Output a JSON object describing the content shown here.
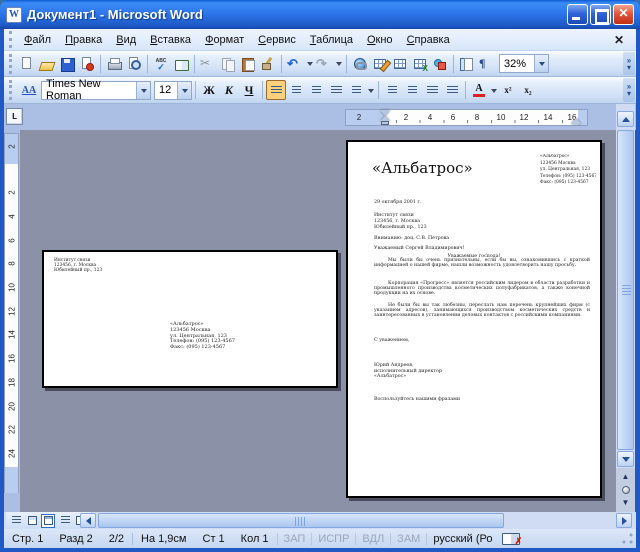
{
  "window": {
    "title": "Документ1 - Microsoft Word"
  },
  "menu": {
    "items": [
      "Файл",
      "Правка",
      "Вид",
      "Вставка",
      "Формат",
      "Сервис",
      "Таблица",
      "Окно",
      "Справка"
    ]
  },
  "standard_toolbar": {
    "zoom_value": "32%",
    "spell_label": "ABC",
    "show_hide_label": "¶",
    "icons": [
      "new",
      "open",
      "save",
      "permission",
      "print",
      "print-preview",
      "spelling",
      "research",
      "cut",
      "copy",
      "paste",
      "format-painter",
      "undo",
      "redo",
      "insert-hyperlink",
      "tables-and-borders",
      "insert-table",
      "insert-excel-worksheet",
      "drawing",
      "document-map",
      "show-hide-paragraph",
      "zoom"
    ]
  },
  "formatting_toolbar": {
    "styles_label": "АА",
    "font_name": "Times New Roman",
    "font_size": "12",
    "bold_label": "Ж",
    "italic_label": "К",
    "underline_label": "Ч",
    "font_color_label": "А",
    "superscript_label": "х²",
    "subscript_label": "х₂"
  },
  "ruler": {
    "h_margin_number": "2",
    "h_numbers": [
      "2",
      "4",
      "6",
      "8",
      "10",
      "12",
      "14",
      "16"
    ],
    "v_margin_number": "2",
    "v_numbers": [
      "2",
      "4",
      "6",
      "8",
      "10",
      "12",
      "14",
      "16",
      "18",
      "20",
      "22",
      "24"
    ]
  },
  "envelope": {
    "return_address": [
      "Институт связи",
      "123456, г. Москва",
      "Юбилейный пр., 123"
    ],
    "recipient": [
      "«Альбатрос»",
      "123456 Москва",
      "ул. Центральная, 123",
      "Телефон: (095) 123-4567",
      "Факс: (095) 123-4567"
    ]
  },
  "letter": {
    "heading": "«Альбатрос»",
    "sender_block": [
      "«Альбатрос»",
      "123456 Москва",
      "ул. Центральная, 123",
      "Телефон: (095) 123-4567",
      "Факс: (095) 123-4567"
    ],
    "date": "29 октября 2001 г.",
    "inside_address": [
      "Институт связи",
      "123456, г. Москва",
      "Юбилейный пр., 123"
    ],
    "attention": "Вниманию: доц. С.В. Петрова",
    "greeting": "Уважаемый Сергей Владимирович!",
    "salutation": "Уважаемые господа!",
    "paragraphs": [
      "Мы были бы очень признательны, если бы вы, ознакомившись с краткой информацией о нашей фирме, нашли возможность удовлетворить нашу просьбу.",
      "Корпорация «Прогресс» является российским лидером в области разработки и промышленного производства косметических полуфабрикатов, а также конечной продукции на их основе.",
      "Не были бы вы так любезны, переслать нам перечень крупнейших фирм (с указанием адресов), занимающихся производством косметических средств и заинтересованных в установлении деловых контактов с российскими компаниями."
    ],
    "closing": "С уважением,",
    "signature": [
      "Юрий Андреев,",
      "исполнительный директор",
      "«Альбатрос»"
    ],
    "slogan": "Воспользуйтесь нашими фразами"
  },
  "status_bar": {
    "page": "Стр. 1",
    "section": "Разд 2",
    "page_of_total": "2/2",
    "position": "На 1,9см",
    "line": "Ст 1",
    "column": "Кол 1",
    "toggles": [
      "ЗАП",
      "ИСПР",
      "ВДЛ",
      "ЗАМ"
    ],
    "language": "русский (Ро"
  }
}
